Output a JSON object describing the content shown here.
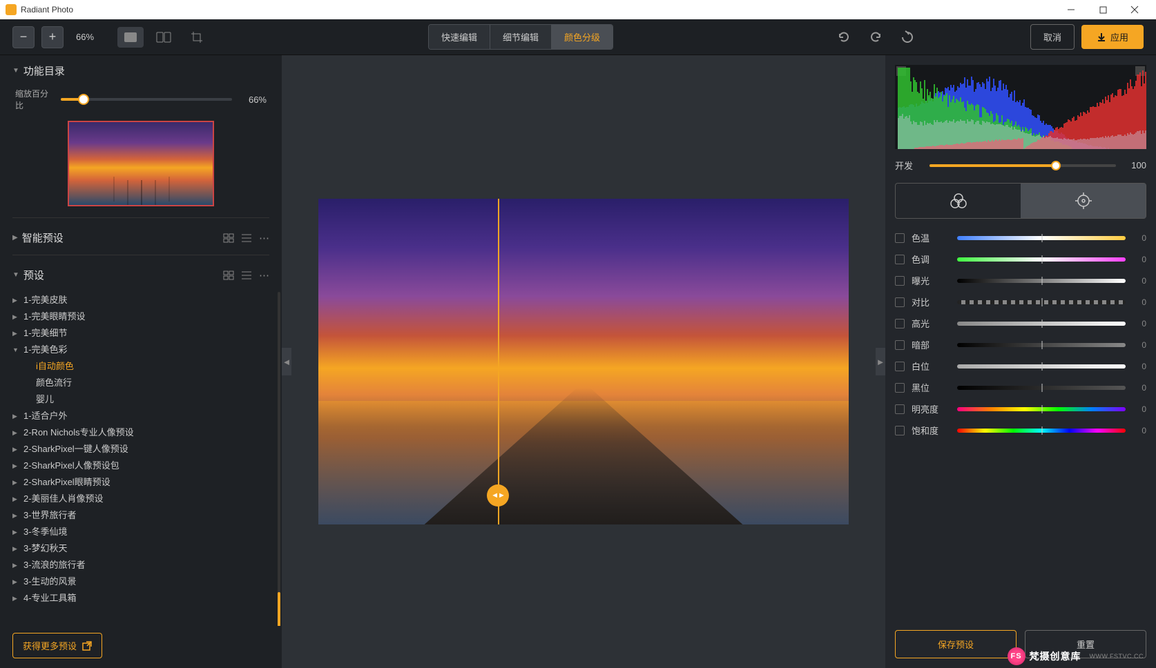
{
  "app": {
    "title": "Radiant Photo"
  },
  "toolbar": {
    "zoom_pct": "66%",
    "tabs": {
      "quick": "快速编辑",
      "detail": "细节编辑",
      "color": "颜色分级"
    },
    "cancel": "取消",
    "apply": "应用"
  },
  "left": {
    "catalog_title": "功能目录",
    "zoom_label": "缩放百分比",
    "zoom_value": "66%",
    "smart_presets": "智能预设",
    "presets_title": "预设",
    "get_more": "获得更多预设",
    "tree": [
      {
        "label": "1-完美皮肤",
        "expanded": false
      },
      {
        "label": "1-完美眼睛预设",
        "expanded": false
      },
      {
        "label": "1-完美细节",
        "expanded": false
      },
      {
        "label": "1-完美色彩",
        "expanded": true,
        "children": [
          {
            "label": "i自动颜色",
            "selected": true
          },
          {
            "label": "颜色流行"
          },
          {
            "label": "婴儿"
          }
        ]
      },
      {
        "label": "1-适合户外",
        "expanded": false
      },
      {
        "label": "2-Ron Nichols专业人像预设",
        "expanded": false
      },
      {
        "label": "2-SharkPixel一键人像预设",
        "expanded": false
      },
      {
        "label": "2-SharkPixel人像预设包",
        "expanded": false
      },
      {
        "label": "2-SharkPixel眼睛预设",
        "expanded": false
      },
      {
        "label": "2-美丽佳人肖像预设",
        "expanded": false
      },
      {
        "label": "3-世界旅行者",
        "expanded": false
      },
      {
        "label": "3-冬季仙境",
        "expanded": false
      },
      {
        "label": "3-梦幻秋天",
        "expanded": false
      },
      {
        "label": "3-流浪的旅行者",
        "expanded": false
      },
      {
        "label": "3-生动的风景",
        "expanded": false
      },
      {
        "label": "4-专业工具箱",
        "expanded": false
      }
    ]
  },
  "right": {
    "develop_label": "开发",
    "develop_value": "100",
    "adjustments": [
      {
        "label": "色温",
        "track": "temp",
        "value": "0"
      },
      {
        "label": "色调",
        "track": "tint",
        "value": "0"
      },
      {
        "label": "曝光",
        "track": "expo",
        "value": "0"
      },
      {
        "label": "对比",
        "track": "contrast",
        "value": "0"
      },
      {
        "label": "高光",
        "track": "hilite",
        "value": "0"
      },
      {
        "label": "暗部",
        "track": "shadow",
        "value": "0"
      },
      {
        "label": "白位",
        "track": "white",
        "value": "0"
      },
      {
        "label": "黑位",
        "track": "black",
        "value": "0"
      },
      {
        "label": "明亮度",
        "track": "vibr",
        "value": "0"
      },
      {
        "label": "饱和度",
        "track": "sat",
        "value": "0"
      }
    ],
    "save_preset": "保存预设",
    "reset": "重置"
  },
  "watermark": {
    "text": "梵摄创意库",
    "url": "WWW.FSTVC.CC"
  }
}
